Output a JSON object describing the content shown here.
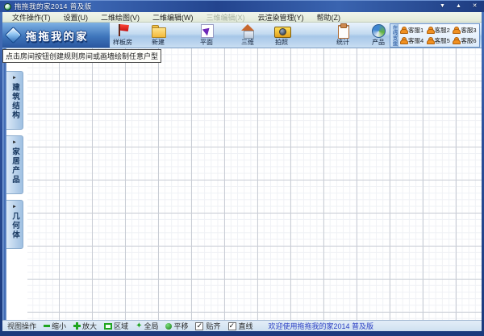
{
  "window": {
    "title": "拖拖我的家2014 普及版",
    "controls": {
      "minimize": "▼",
      "maximize": "▲",
      "close": "✕"
    }
  },
  "menu_bar": {
    "items": [
      {
        "label": "文件操作(T)",
        "enabled": true
      },
      {
        "label": "设置(U)",
        "enabled": true
      },
      {
        "label": "二维绘图(V)",
        "enabled": true
      },
      {
        "label": "二维编辑(W)",
        "enabled": true
      },
      {
        "label": "三维编辑(X)",
        "enabled": false
      },
      {
        "label": "云渲染管理(Y)",
        "enabled": true
      },
      {
        "label": "帮助(Z)",
        "enabled": true
      }
    ]
  },
  "toolbar": {
    "logo_text": "拖拖我的家",
    "buttons": [
      {
        "label": "样板房",
        "icon": "flag-icon"
      },
      {
        "label": "新建",
        "icon": "folder-icon"
      },
      {
        "label": "平面",
        "icon": "plan-icon"
      },
      {
        "label": "三维",
        "icon": "house-icon"
      },
      {
        "label": "拍照",
        "icon": "camera-icon"
      },
      {
        "label": "统计",
        "icon": "stats-icon"
      },
      {
        "label": "产品",
        "icon": "product-icon"
      }
    ],
    "support_panel": {
      "title": "在线支援",
      "agents": [
        "客服1",
        "客服2",
        "客服3",
        "客服4",
        "客服5",
        "客服6"
      ]
    }
  },
  "tooltip": "点击房间按钮创建规则房间或画墙绘制任意户型",
  "sidebar": {
    "tabs": [
      {
        "label": "建筑结构"
      },
      {
        "label": "家居产品"
      },
      {
        "label": "几何体"
      }
    ]
  },
  "statusbar": {
    "section_label": "视图操作",
    "tools": [
      {
        "label": "缩小",
        "icon": "zoom-out-icon"
      },
      {
        "label": "放大",
        "icon": "zoom-in-icon"
      },
      {
        "label": "区域",
        "icon": "region-zoom-icon"
      },
      {
        "label": "全局",
        "icon": "fit-all-icon"
      },
      {
        "label": "平移",
        "icon": "pan-icon"
      }
    ],
    "toggles": [
      {
        "label": "贴齐",
        "checked": true
      },
      {
        "label": "直线",
        "checked": true
      }
    ],
    "welcome": "欢迎使用拖拖我的家2014 普及版"
  },
  "icons": {
    "tab_arrow": "►",
    "fit_all_glyph": "✦",
    "check_mark": "✓"
  },
  "colors": {
    "titlebar_blue": "#2c4f9a",
    "toolbar_blue": "#b8d4ee",
    "tab_text": "#16365e",
    "status_green": "#1fa51f",
    "agent_orange": "#f09020",
    "welcome_text": "#2b3fc4",
    "grid_major": "#c9cdd5",
    "grid_minor": "#eff1f5"
  }
}
